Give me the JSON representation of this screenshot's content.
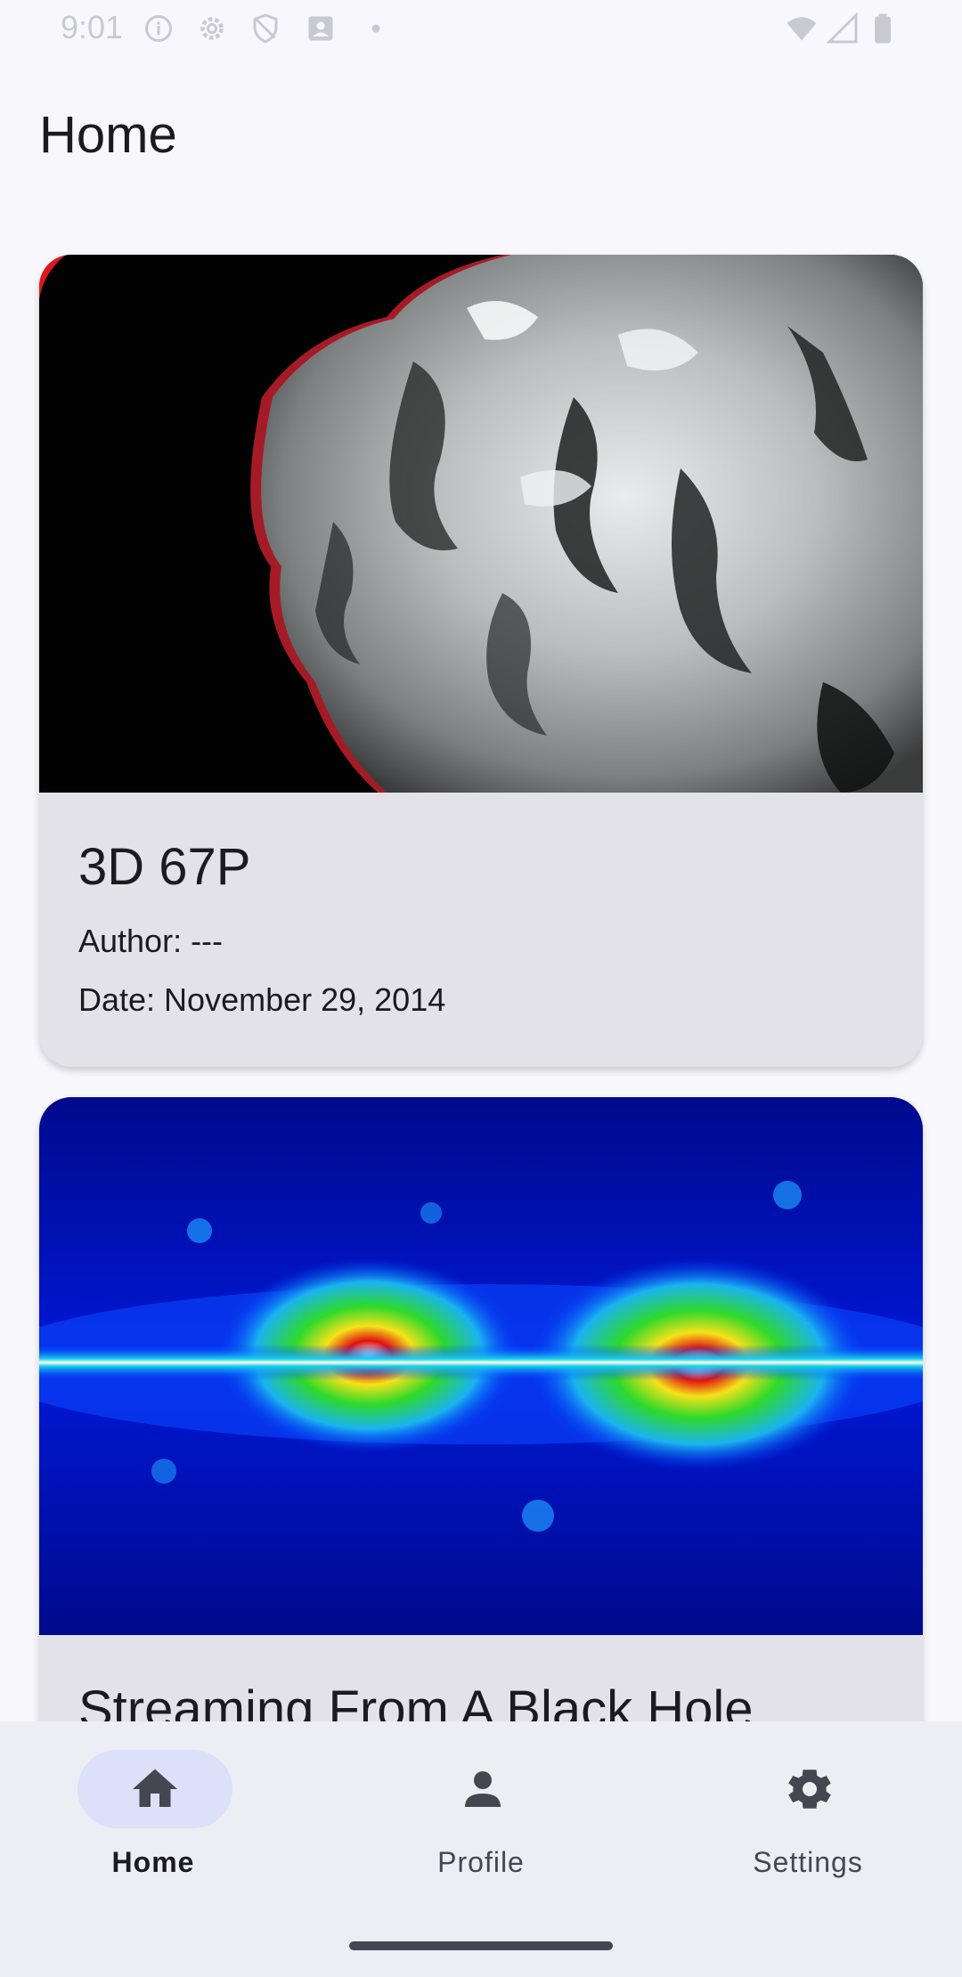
{
  "status_bar": {
    "time": "9:01",
    "icons": [
      "info-icon",
      "gear-icon",
      "shield-icon",
      "account-box-icon",
      "dot-icon",
      "wifi-icon",
      "signal-icon",
      "battery-icon"
    ]
  },
  "app_bar": {
    "title": "Home"
  },
  "feed": {
    "items": [
      {
        "title": "3D 67P",
        "author": "Author: ---",
        "date": "Date: November 29, 2014",
        "image": "comet-67p-anaglyph-photo"
      },
      {
        "title": "Streaming From A Black Hole",
        "image": "black-hole-false-color-photo"
      }
    ]
  },
  "bottom_nav": {
    "items": [
      {
        "label": "Home",
        "icon": "home-icon",
        "selected": true
      },
      {
        "label": "Profile",
        "icon": "person-icon",
        "selected": false
      },
      {
        "label": "Settings",
        "icon": "gear-icon",
        "selected": false
      }
    ]
  },
  "colors": {
    "background": "#F8F7FC",
    "card": "#E3E2E8",
    "nav_background": "#EDEDF4",
    "nav_active_pill": "#DCE1F9",
    "icon": "#45464F"
  }
}
